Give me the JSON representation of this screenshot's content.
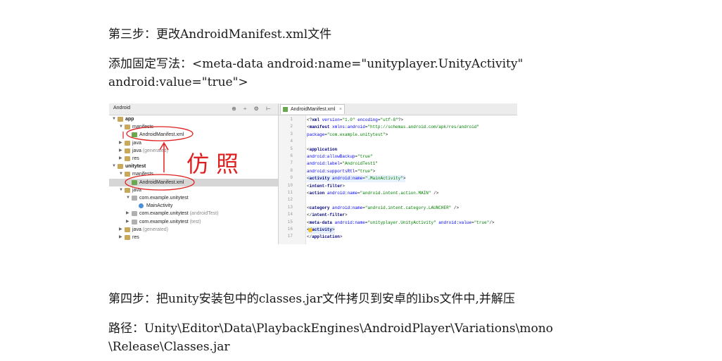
{
  "step3": "第三步：更改AndroidManifest.xml文件",
  "add_line1": "添加固定写法：<meta-data android:name=\"unityplayer.UnityActivity\"",
  "add_line2": "android:value=\"true\">",
  "ide": {
    "project_view": "Android",
    "tools": "⊕ ÷ ⚙ ⊢",
    "tree": [
      {
        "label": "app",
        "indent": 0,
        "icon": "module",
        "arrow": "▼",
        "bold": true
      },
      {
        "label": "manifests",
        "indent": 1,
        "icon": "folder",
        "arrow": "▼"
      },
      {
        "label": "AndroidManifest.xml",
        "indent": 2,
        "icon": "xml",
        "arrow": ""
      },
      {
        "label": "java",
        "indent": 1,
        "icon": "folder",
        "arrow": "▶"
      },
      {
        "label": "java",
        "suffix": " (generated)",
        "indent": 1,
        "icon": "folder",
        "arrow": "▶"
      },
      {
        "label": "res",
        "indent": 1,
        "icon": "folder",
        "arrow": "▶"
      },
      {
        "label": "unitytest",
        "indent": 0,
        "icon": "module",
        "arrow": "▼",
        "bold": true
      },
      {
        "label": "manifests",
        "indent": 1,
        "icon": "folder",
        "arrow": "▼"
      },
      {
        "label": "AndroidManifest.xml",
        "indent": 2,
        "icon": "xml",
        "arrow": "",
        "selected": true
      },
      {
        "label": "java",
        "indent": 1,
        "icon": "folder",
        "arrow": "▼"
      },
      {
        "label": "com.example.unitytest",
        "indent": 2,
        "icon": "pkg",
        "arrow": "▼"
      },
      {
        "label": "MainActivity",
        "indent": 3,
        "icon": "class",
        "arrow": ""
      },
      {
        "label": "com.example.unitytest",
        "suffix": " (androidTest)",
        "indent": 2,
        "icon": "pkg",
        "arrow": "▶"
      },
      {
        "label": "com.example.unitytest",
        "suffix": " (test)",
        "indent": 2,
        "icon": "pkg",
        "arrow": "▶"
      },
      {
        "label": "java",
        "suffix": " (generated)",
        "indent": 1,
        "icon": "folder",
        "arrow": "▶"
      },
      {
        "label": "res",
        "indent": 1,
        "icon": "folder",
        "arrow": "▶"
      }
    ],
    "tab_label": "AndroidManifest.xml",
    "tab_close": "×",
    "line_numbers": [
      "1",
      "2",
      "3",
      "4",
      "5",
      "6",
      "7",
      "8",
      "9",
      "10",
      "11",
      "12",
      "13",
      "14",
      "15",
      "16",
      "17"
    ],
    "code_lines": [
      "<?xml version=\"1.0\" encoding=\"utf-8\"?>",
      "<manifest xmlns:android=\"http://schemas.android.com/apk/res/android\"",
      "    package=\"com.example.unitytest\">",
      "",
      "    <application",
      "        android:allowBackup=\"true\"",
      "        android:label=\"AndroidTest1\"",
      "        android:supportsRtl=\"true\">",
      "        <activity android:name=\".MainActivity\">",
      "            <intent-filter>",
      "                <action android:name=\"android.intent.action.MAIN\" />",
      "",
      "                <category android:name=\"android.intent.category.LAUNCHER\" />",
      "            </intent-filter>",
      "            <meta-data android:name=\"unityplayer.UnityActivity\" android:value=\"true\"/>",
      "        </activity>",
      "    </application>"
    ],
    "annotation": "仿照"
  },
  "step4": "第四步：把unity安装包中的classes.jar文件拷贝到安卓的libs文件中,并解压",
  "path_line1": "路径：Unity\\Editor\\Data\\PlaybackEngines\\AndroidPlayer\\Variations\\mono",
  "path_line2": "\\Release\\Classes.jar",
  "colors": {
    "annotation": "#e02020",
    "selection": "#d6d6d6"
  }
}
